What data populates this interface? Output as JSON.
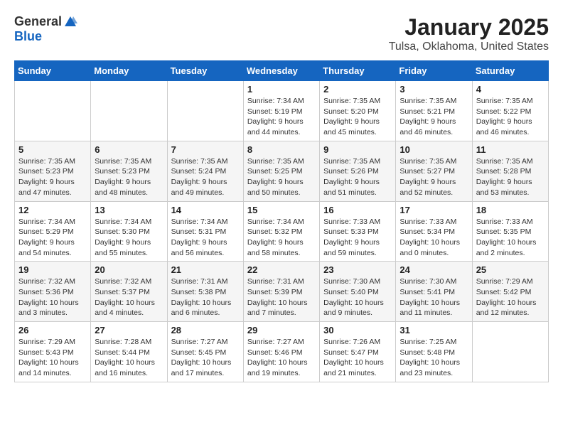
{
  "header": {
    "logo_general": "General",
    "logo_blue": "Blue",
    "month_title": "January 2025",
    "location": "Tulsa, Oklahoma, United States"
  },
  "weekdays": [
    "Sunday",
    "Monday",
    "Tuesday",
    "Wednesday",
    "Thursday",
    "Friday",
    "Saturday"
  ],
  "weeks": [
    [
      {
        "day": "",
        "info": ""
      },
      {
        "day": "",
        "info": ""
      },
      {
        "day": "",
        "info": ""
      },
      {
        "day": "1",
        "info": "Sunrise: 7:34 AM\nSunset: 5:19 PM\nDaylight: 9 hours\nand 44 minutes."
      },
      {
        "day": "2",
        "info": "Sunrise: 7:35 AM\nSunset: 5:20 PM\nDaylight: 9 hours\nand 45 minutes."
      },
      {
        "day": "3",
        "info": "Sunrise: 7:35 AM\nSunset: 5:21 PM\nDaylight: 9 hours\nand 46 minutes."
      },
      {
        "day": "4",
        "info": "Sunrise: 7:35 AM\nSunset: 5:22 PM\nDaylight: 9 hours\nand 46 minutes."
      }
    ],
    [
      {
        "day": "5",
        "info": "Sunrise: 7:35 AM\nSunset: 5:23 PM\nDaylight: 9 hours\nand 47 minutes."
      },
      {
        "day": "6",
        "info": "Sunrise: 7:35 AM\nSunset: 5:23 PM\nDaylight: 9 hours\nand 48 minutes."
      },
      {
        "day": "7",
        "info": "Sunrise: 7:35 AM\nSunset: 5:24 PM\nDaylight: 9 hours\nand 49 minutes."
      },
      {
        "day": "8",
        "info": "Sunrise: 7:35 AM\nSunset: 5:25 PM\nDaylight: 9 hours\nand 50 minutes."
      },
      {
        "day": "9",
        "info": "Sunrise: 7:35 AM\nSunset: 5:26 PM\nDaylight: 9 hours\nand 51 minutes."
      },
      {
        "day": "10",
        "info": "Sunrise: 7:35 AM\nSunset: 5:27 PM\nDaylight: 9 hours\nand 52 minutes."
      },
      {
        "day": "11",
        "info": "Sunrise: 7:35 AM\nSunset: 5:28 PM\nDaylight: 9 hours\nand 53 minutes."
      }
    ],
    [
      {
        "day": "12",
        "info": "Sunrise: 7:34 AM\nSunset: 5:29 PM\nDaylight: 9 hours\nand 54 minutes."
      },
      {
        "day": "13",
        "info": "Sunrise: 7:34 AM\nSunset: 5:30 PM\nDaylight: 9 hours\nand 55 minutes."
      },
      {
        "day": "14",
        "info": "Sunrise: 7:34 AM\nSunset: 5:31 PM\nDaylight: 9 hours\nand 56 minutes."
      },
      {
        "day": "15",
        "info": "Sunrise: 7:34 AM\nSunset: 5:32 PM\nDaylight: 9 hours\nand 58 minutes."
      },
      {
        "day": "16",
        "info": "Sunrise: 7:33 AM\nSunset: 5:33 PM\nDaylight: 9 hours\nand 59 minutes."
      },
      {
        "day": "17",
        "info": "Sunrise: 7:33 AM\nSunset: 5:34 PM\nDaylight: 10 hours\nand 0 minutes."
      },
      {
        "day": "18",
        "info": "Sunrise: 7:33 AM\nSunset: 5:35 PM\nDaylight: 10 hours\nand 2 minutes."
      }
    ],
    [
      {
        "day": "19",
        "info": "Sunrise: 7:32 AM\nSunset: 5:36 PM\nDaylight: 10 hours\nand 3 minutes."
      },
      {
        "day": "20",
        "info": "Sunrise: 7:32 AM\nSunset: 5:37 PM\nDaylight: 10 hours\nand 4 minutes."
      },
      {
        "day": "21",
        "info": "Sunrise: 7:31 AM\nSunset: 5:38 PM\nDaylight: 10 hours\nand 6 minutes."
      },
      {
        "day": "22",
        "info": "Sunrise: 7:31 AM\nSunset: 5:39 PM\nDaylight: 10 hours\nand 7 minutes."
      },
      {
        "day": "23",
        "info": "Sunrise: 7:30 AM\nSunset: 5:40 PM\nDaylight: 10 hours\nand 9 minutes."
      },
      {
        "day": "24",
        "info": "Sunrise: 7:30 AM\nSunset: 5:41 PM\nDaylight: 10 hours\nand 11 minutes."
      },
      {
        "day": "25",
        "info": "Sunrise: 7:29 AM\nSunset: 5:42 PM\nDaylight: 10 hours\nand 12 minutes."
      }
    ],
    [
      {
        "day": "26",
        "info": "Sunrise: 7:29 AM\nSunset: 5:43 PM\nDaylight: 10 hours\nand 14 minutes."
      },
      {
        "day": "27",
        "info": "Sunrise: 7:28 AM\nSunset: 5:44 PM\nDaylight: 10 hours\nand 16 minutes."
      },
      {
        "day": "28",
        "info": "Sunrise: 7:27 AM\nSunset: 5:45 PM\nDaylight: 10 hours\nand 17 minutes."
      },
      {
        "day": "29",
        "info": "Sunrise: 7:27 AM\nSunset: 5:46 PM\nDaylight: 10 hours\nand 19 minutes."
      },
      {
        "day": "30",
        "info": "Sunrise: 7:26 AM\nSunset: 5:47 PM\nDaylight: 10 hours\nand 21 minutes."
      },
      {
        "day": "31",
        "info": "Sunrise: 7:25 AM\nSunset: 5:48 PM\nDaylight: 10 hours\nand 23 minutes."
      },
      {
        "day": "",
        "info": ""
      }
    ]
  ]
}
